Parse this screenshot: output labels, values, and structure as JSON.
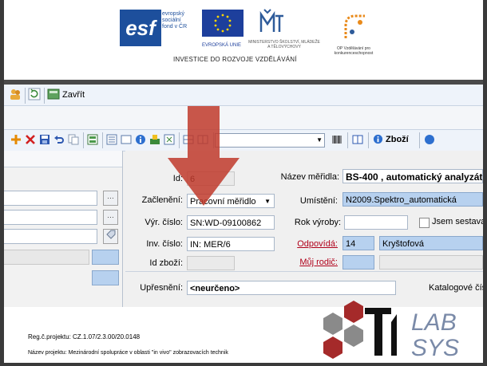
{
  "banner": {
    "esf_logo_text": "esf",
    "esf_subtext": "evropský\nsociální\nfond v ČR",
    "eu_text": "EVROPSKÁ UNIE",
    "msmt_logo_text": "MŠMT",
    "msmt_subtext": "MINISTERSTVO ŠKOLSTVÍ, MLÁDEŽE A TĚLOVÝCHOVY",
    "oppk_subtext": "OP Vzdělávání pro konkurenceschopnost",
    "caption": "INVESTICE DO ROZVOJE VZDĚLÁVÁNÍ"
  },
  "toolbar1": {
    "close_label": "Zavřít"
  },
  "toolbar2": {
    "combo_value": "",
    "zbozi_label": "Zboží"
  },
  "form": {
    "id_label": "Id:",
    "id_value": "6",
    "nazev_label": "Název měřidla:",
    "nazev_value": "BS-400 , automatický analyzát",
    "zacleneni_label": "Začlenění:",
    "zacleneni_value": "Pracovní měřidlo",
    "umisteni_label": "Umístění:",
    "umisteni_value": "N2009.Spektro_automatická",
    "vyr_cislo_label": "Výr. číslo:",
    "vyr_cislo_value": "SN:WD-09100862",
    "rok_vyroby_label": "Rok výroby:",
    "rok_vyroby_value": "",
    "jsem_sestava_label": "Jsem sestava(n",
    "inv_cislo_label": "Inv. číslo:",
    "inv_cislo_value": "IN: MER/6",
    "odpovida_label": "Odpovídá:",
    "odpovida_code": "14",
    "odpovida_name": "Kryštofová",
    "id_zbozi_label": "Id zboží:",
    "id_zbozi_value": "",
    "muj_rodic_label": "Můj rodič:",
    "upresneni_label": "Upřesnění:",
    "upresneni_value": "<neurčeno>",
    "katalogove_label": "Katalogové čís"
  },
  "footer": {
    "line1": "Reg.č.projektu: CZ.1.07/2.3.00/20.0148",
    "line2": "Název projektu: Mezinárodní spolupráce v oblasti \"in vivo\" zobrazovacích technik",
    "logo_text_top": "LAB",
    "logo_text_bottom": "SYS"
  },
  "colors": {
    "arrow": "#c0392b",
    "field_blue": "#b7d1ef",
    "link_red": "#b0001a"
  }
}
